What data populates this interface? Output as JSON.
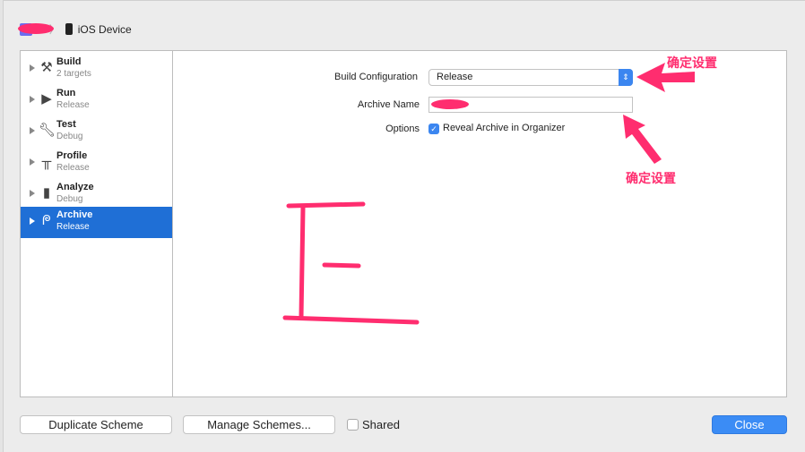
{
  "breadcrumb": {
    "scheme": "e",
    "destination": "iOS Device"
  },
  "sidebar": {
    "items": [
      {
        "label": "Build",
        "sub": "2 targets",
        "icon": "hammer-icon"
      },
      {
        "label": "Run",
        "sub": "Release",
        "icon": "play-icon"
      },
      {
        "label": "Test",
        "sub": "Debug",
        "icon": "wrench-icon"
      },
      {
        "label": "Profile",
        "sub": "Release",
        "icon": "instruments-icon"
      },
      {
        "label": "Analyze",
        "sub": "Debug",
        "icon": "analyze-icon"
      },
      {
        "label": "Archive",
        "sub": "Release",
        "icon": "archive-icon",
        "selected": true
      }
    ]
  },
  "form": {
    "build_config_label": "Build Configuration",
    "build_config_value": "Release",
    "archive_name_label": "Archive Name",
    "archive_name_value": "",
    "options_label": "Options",
    "reveal_label": "Reveal Archive in Organizer",
    "reveal_checked": true
  },
  "footer": {
    "duplicate": "Duplicate Scheme",
    "manage": "Manage Schemes...",
    "shared": "Shared",
    "shared_checked": false,
    "close": "Close"
  },
  "annotations": {
    "note1": "确定设置",
    "note2": "确定设置",
    "accent": "#ff2d6f"
  }
}
